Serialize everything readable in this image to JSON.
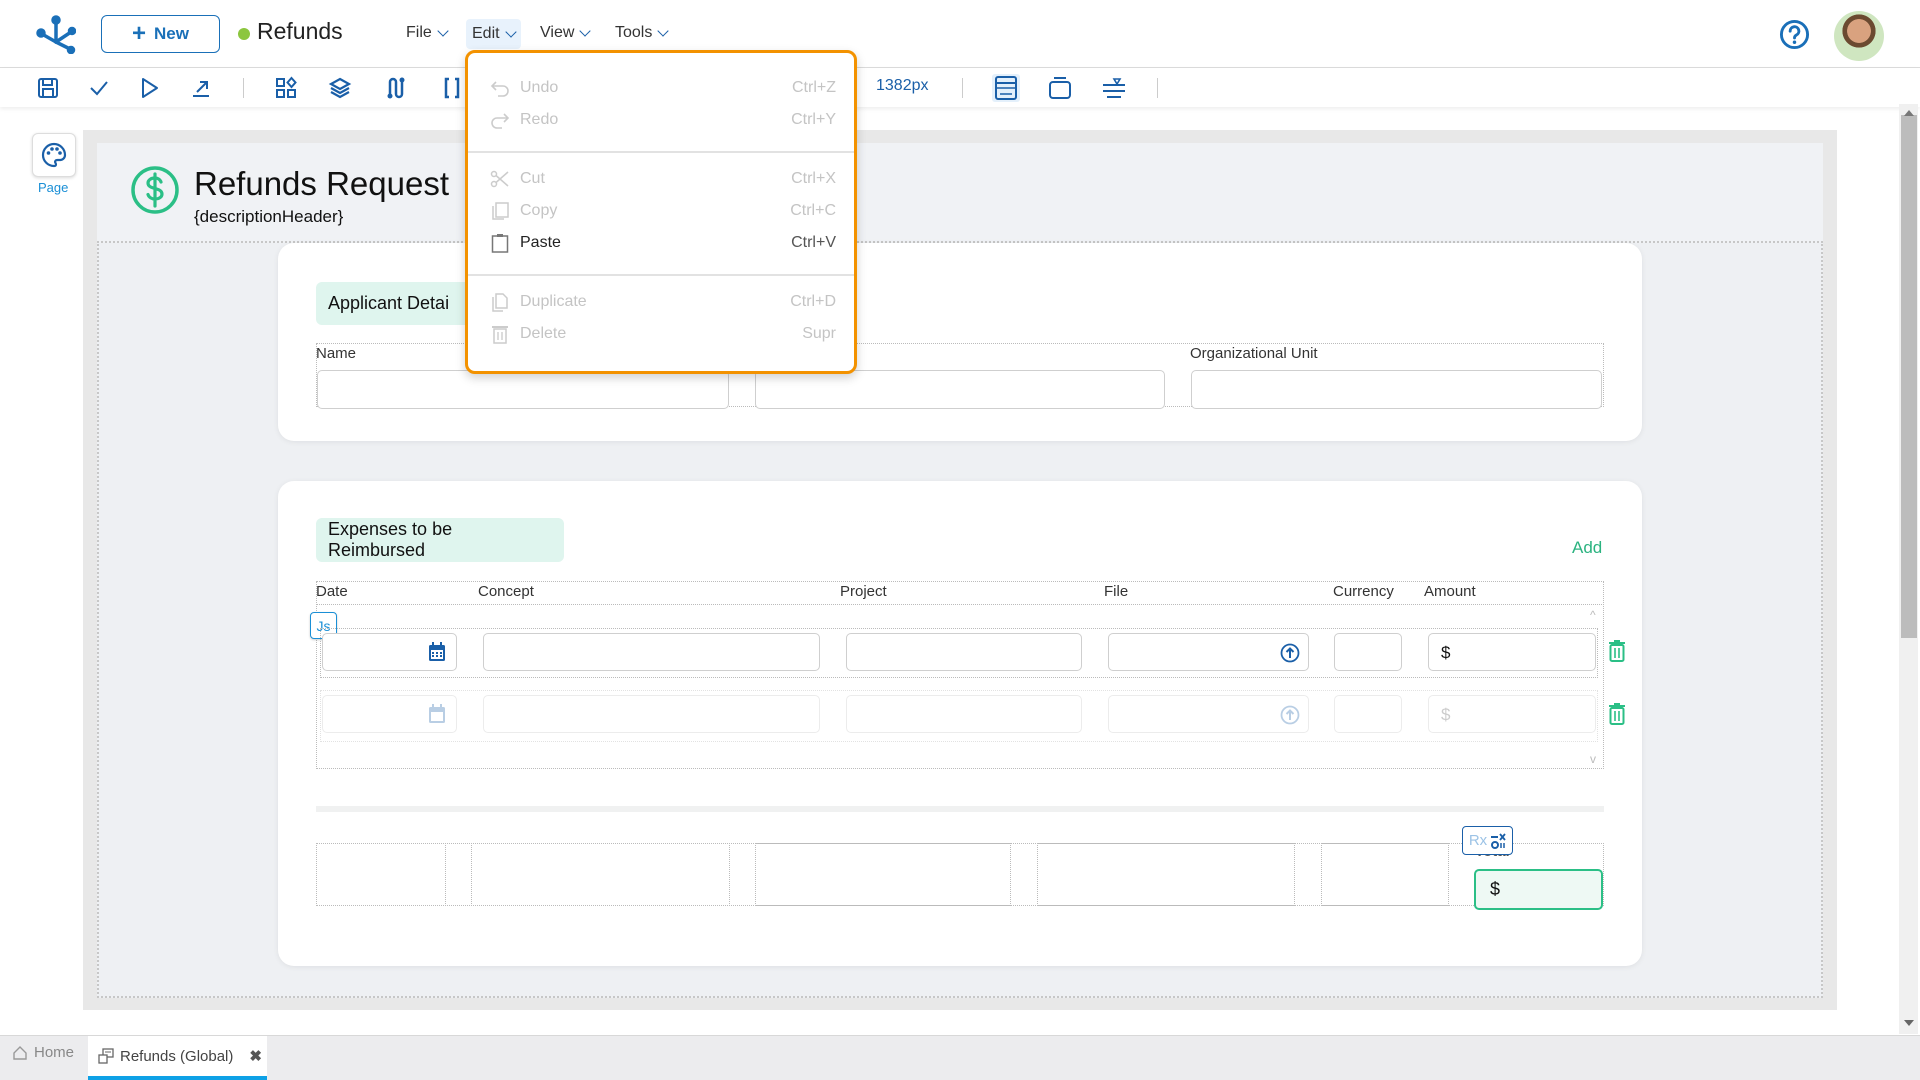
{
  "header": {
    "new_button": "New",
    "app_title": "Refunds",
    "status_color": "#8cc63f",
    "menus": [
      {
        "label": "File"
      },
      {
        "label": "Edit"
      },
      {
        "label": "View"
      },
      {
        "label": "Tools"
      }
    ],
    "help_icon": "question-circle-icon",
    "avatar": "user-avatar"
  },
  "toolbar": {
    "icons": [
      "save-icon",
      "check-icon",
      "play-icon",
      "export-icon",
      "components-icon",
      "layers-icon",
      "flow-icon",
      "braces-icon",
      "layout-icon",
      "frame-icon",
      "align-icon"
    ],
    "zoom_readout": "1382px"
  },
  "left_rail": {
    "page_label": "Page",
    "page_icon": "palette-icon"
  },
  "form": {
    "title": "Refunds Request",
    "description": "{descriptionHeader}",
    "applicant": {
      "title": "Applicant Detai",
      "fields": [
        {
          "label": "Name",
          "value": ""
        },
        {
          "label": "",
          "value": ""
        },
        {
          "label": "Organizational Unit",
          "value": ""
        }
      ]
    },
    "expenses": {
      "title": "Expenses to be Reimbursed",
      "add_label": "Add",
      "columns": [
        "Date",
        "Concept",
        "Project",
        "File",
        "Currency",
        "Amount"
      ],
      "js_badge": "Js",
      "rows": [
        {
          "date": "",
          "concept": "",
          "project": "",
          "file": "",
          "currency": "",
          "amount": "$"
        },
        {
          "date": "",
          "concept": "",
          "project": "",
          "file": "",
          "currency": "",
          "amount": "$"
        }
      ],
      "total_label": "Total",
      "total_value": "$",
      "rx_badge": "Rx"
    }
  },
  "edit_menu": {
    "groups": [
      [
        {
          "label": "Undo",
          "shortcut": "Ctrl+Z",
          "icon": "undo-icon",
          "enabled": false
        },
        {
          "label": "Redo",
          "shortcut": "Ctrl+Y",
          "icon": "redo-icon",
          "enabled": false
        }
      ],
      [
        {
          "label": "Cut",
          "shortcut": "Ctrl+X",
          "icon": "scissors-icon",
          "enabled": false
        },
        {
          "label": "Copy",
          "shortcut": "Ctrl+C",
          "icon": "copy-icon",
          "enabled": false
        },
        {
          "label": "Paste",
          "shortcut": "Ctrl+V",
          "icon": "clipboard-icon",
          "enabled": true
        }
      ],
      [
        {
          "label": "Duplicate",
          "shortcut": "Ctrl+D",
          "icon": "duplicate-icon",
          "enabled": false
        },
        {
          "label": "Delete",
          "shortcut": "Supr",
          "icon": "trash-icon",
          "enabled": false
        }
      ]
    ]
  },
  "bottom_tabs": [
    {
      "label": "Home",
      "icon": "home-icon",
      "active": false
    },
    {
      "label": "Refunds (Global)",
      "icon": "form-icon",
      "active": true
    }
  ],
  "colors": {
    "accent_blue": "#1a5fa8",
    "accent_green": "#2bbf86",
    "dropdown_border": "#f39200",
    "active_tab": "#0ea1e6"
  }
}
